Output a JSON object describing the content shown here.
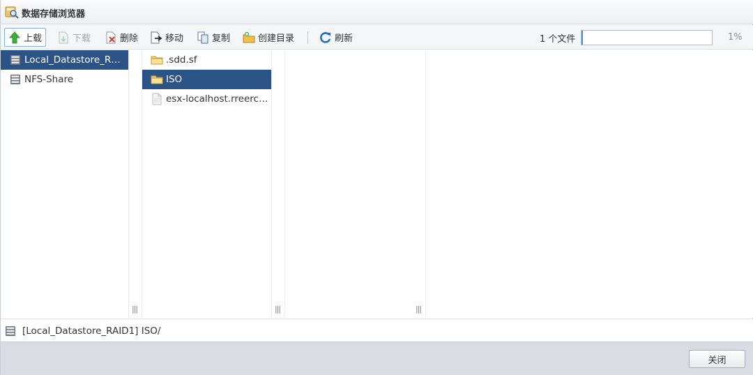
{
  "window": {
    "title": "数据存储浏览器"
  },
  "toolbar": {
    "upload_label": "上载",
    "download_label": "下载",
    "delete_label": "删除",
    "move_label": "移动",
    "copy_label": "复制",
    "mkdir_label": "创建目录",
    "refresh_label": "刷新",
    "file_count": "1 个文件",
    "progress_percent": 1,
    "progress_label": "1%"
  },
  "datastores": [
    {
      "label": "Local_Datastore_R…",
      "selected": true,
      "icon": "datastore-icon"
    },
    {
      "label": "NFS-Share",
      "selected": false,
      "icon": "datastore-icon"
    }
  ],
  "files": [
    {
      "label": ".sdd.sf",
      "selected": false,
      "icon": "folder-icon"
    },
    {
      "label": "ISO",
      "selected": true,
      "icon": "folder-icon"
    },
    {
      "label": "esx-localhost.rreerc…",
      "selected": false,
      "icon": "file-icon"
    }
  ],
  "pathbar": {
    "path": "[Local_Datastore_RAID1] ISO/"
  },
  "footer": {
    "close_label": "关闭"
  },
  "colors": {
    "selection": "#2c5386",
    "footer_bg": "#d9dde3",
    "accent": "#4a8fcf"
  }
}
